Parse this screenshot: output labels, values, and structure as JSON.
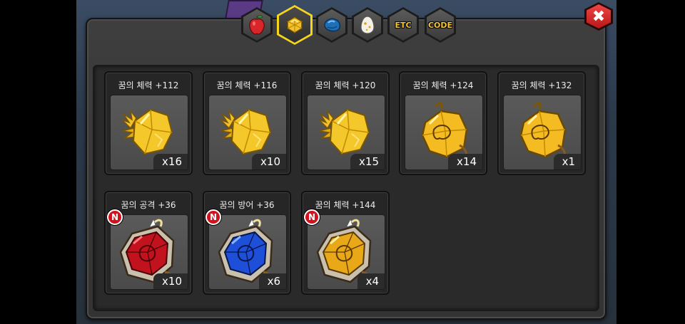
{
  "tabs": [
    {
      "id": "tab-fruit",
      "label": "",
      "icon": "red-fruit-icon",
      "active": false
    },
    {
      "id": "tab-gem",
      "label": "",
      "icon": "yellow-gem-icon",
      "active": true
    },
    {
      "id": "tab-material",
      "label": "",
      "icon": "blue-stone-icon",
      "active": false
    },
    {
      "id": "tab-egg",
      "label": "",
      "icon": "egg-icon",
      "active": false
    },
    {
      "id": "tab-etc",
      "label": "ETC",
      "icon": "",
      "active": false
    },
    {
      "id": "tab-code",
      "label": "CODE",
      "icon": "",
      "active": false
    }
  ],
  "close": {
    "label": "✖",
    "icon": "close-icon"
  },
  "items": [
    {
      "title": "꿈의 체력 +112",
      "count": "x16",
      "gem": "gold-wing",
      "is_new": false
    },
    {
      "title": "꿈의 체력 +116",
      "count": "x10",
      "gem": "gold-wing",
      "is_new": false
    },
    {
      "title": "꿈의 체력 +120",
      "count": "x15",
      "gem": "gold-wing",
      "is_new": false
    },
    {
      "title": "꿈의 체력 +124",
      "count": "x14",
      "gem": "gold-dragon",
      "is_new": false
    },
    {
      "title": "꿈의 체력 +132",
      "count": "x1",
      "gem": "gold-dragon",
      "is_new": false
    },
    {
      "title": "꿈의 공격 +36",
      "count": "x10",
      "gem": "red-framed",
      "is_new": true
    },
    {
      "title": "꿈의 방어 +36",
      "count": "x6",
      "gem": "blue-framed",
      "is_new": true
    },
    {
      "title": "꿈의 체력 +144",
      "count": "x4",
      "gem": "gold-framed",
      "is_new": true
    }
  ],
  "new_badge_label": "N",
  "colors": {
    "active_tab": "#f4d61a",
    "gold": "#f2c12e",
    "red": "#c2121e",
    "blue": "#1d4fd8",
    "close": "#e33a3a"
  }
}
